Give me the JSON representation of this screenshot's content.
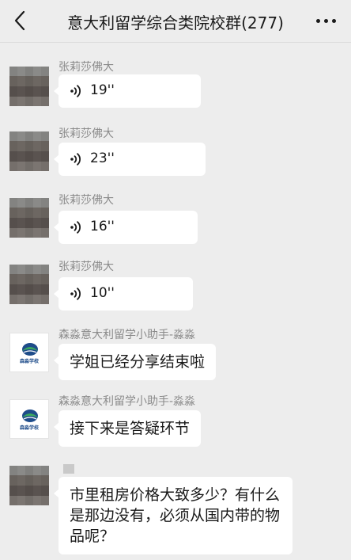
{
  "header": {
    "title": "意大利留学综合类院校群(277)",
    "back_icon": "chevron-left-icon",
    "more_icon": "more-dots-icon"
  },
  "messages": [
    {
      "sender": "张莉莎佛大",
      "type": "voice",
      "duration": "19''"
    },
    {
      "sender": "张莉莎佛大",
      "type": "voice",
      "duration": "23''"
    },
    {
      "sender": "张莉莎佛大",
      "type": "voice",
      "duration": "16''"
    },
    {
      "sender": "张莉莎佛大",
      "type": "voice",
      "duration": "10''"
    },
    {
      "sender": "森淼意大利留学小助手-淼淼",
      "type": "text",
      "text": "学姐已经分享结束啦",
      "avatar_caption": "森淼学校"
    },
    {
      "sender": "森淼意大利留学小助手-淼淼",
      "type": "text",
      "text": "接下来是答疑环节",
      "avatar_caption": "森淼学校"
    },
    {
      "sender": "",
      "type": "text",
      "text": "市里租房价格大致多少？有什么是那边没有，必须从国内带的物品呢？"
    }
  ],
  "colors": {
    "background": "#ededed",
    "bubble": "#ffffff",
    "sender_name": "#8a8a8a",
    "logo_blue": "#1e4c8a",
    "logo_green": "#3aa860"
  }
}
